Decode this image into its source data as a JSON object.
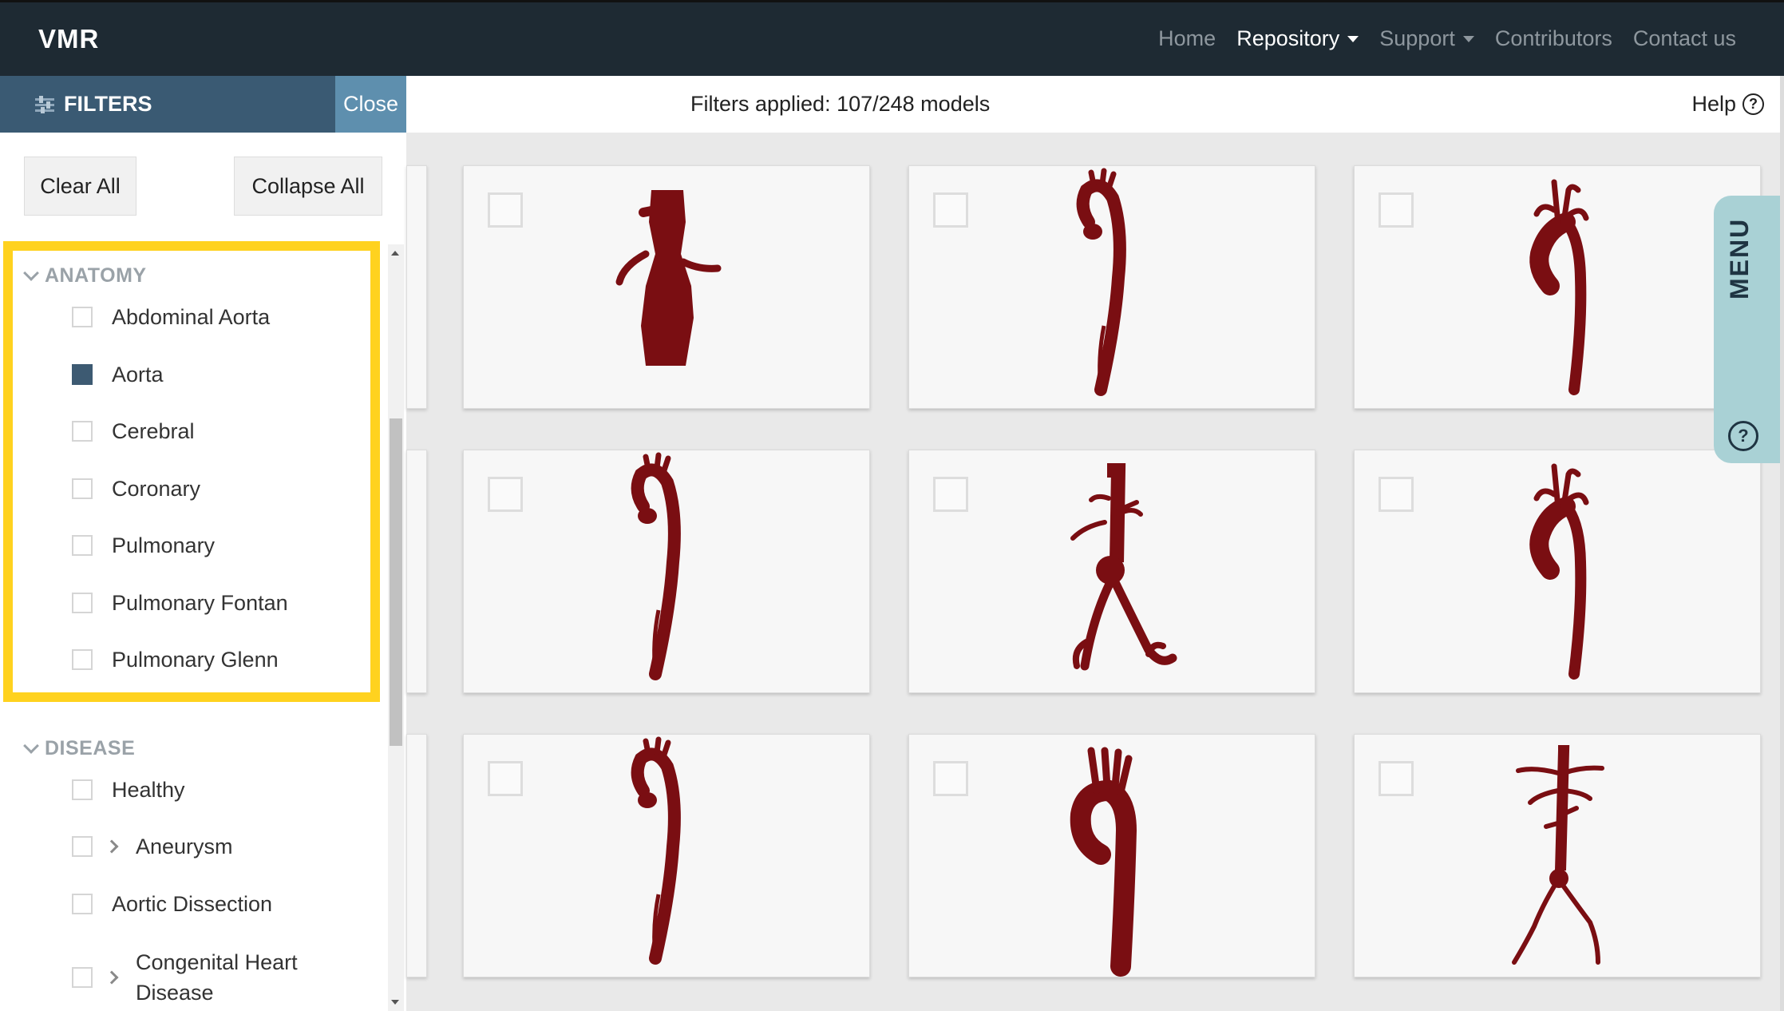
{
  "navbar": {
    "brand": "VMR",
    "links": [
      {
        "label": "Home",
        "dropdown": false,
        "active": false
      },
      {
        "label": "Repository",
        "dropdown": true,
        "active": true
      },
      {
        "label": "Support",
        "dropdown": true,
        "active": false
      },
      {
        "label": "Contributors",
        "dropdown": false,
        "active": false
      },
      {
        "label": "Contact us",
        "dropdown": false,
        "active": false
      }
    ]
  },
  "filters_panel": {
    "title": "FILTERS",
    "close_label": "Close",
    "clear_all_label": "Clear All",
    "collapse_all_label": "Collapse All",
    "sections": [
      {
        "title": "ANATOMY",
        "options": [
          {
            "label": "Abdominal Aorta",
            "checked": false
          },
          {
            "label": "Aorta",
            "checked": true
          },
          {
            "label": "Cerebral",
            "checked": false
          },
          {
            "label": "Coronary",
            "checked": false
          },
          {
            "label": "Pulmonary",
            "checked": false
          },
          {
            "label": "Pulmonary Fontan",
            "checked": false
          },
          {
            "label": "Pulmonary Glenn",
            "checked": false
          }
        ]
      },
      {
        "title": "DISEASE",
        "options": [
          {
            "label": "Healthy",
            "checked": false,
            "expandable": false
          },
          {
            "label": "Aneurysm",
            "checked": false,
            "expandable": true
          },
          {
            "label": "Aortic Dissection",
            "checked": false,
            "expandable": false
          },
          {
            "label": "Congenital Heart Disease",
            "checked": false,
            "expandable": true
          }
        ]
      }
    ]
  },
  "topbar": {
    "filters_applied": "Filters applied: 107/248 models",
    "help_label": "Help"
  },
  "side_menu": {
    "label": "MENU"
  },
  "models": [
    {
      "shape": "abdominal-aorta",
      "checked": false
    },
    {
      "shape": "aortic-arch-long",
      "checked": false
    },
    {
      "shape": "arch-branches",
      "checked": false
    },
    {
      "shape": "aortic-arch-long",
      "checked": false
    },
    {
      "shape": "abdominal-bifurcation",
      "checked": false
    },
    {
      "shape": "arch-branches",
      "checked": false
    },
    {
      "shape": "aortic-arch-long",
      "checked": false
    },
    {
      "shape": "thick-arch",
      "checked": false
    },
    {
      "shape": "thin-bifurcation",
      "checked": false
    }
  ],
  "colors": {
    "navbar_bg": "#1e2a33",
    "filters_header_bg": "#3a5a73",
    "close_bg": "#5e8fae",
    "highlight_border": "#ffd21f",
    "vessel": "#7a0e12",
    "menu_tab": "#a9d1d5"
  }
}
